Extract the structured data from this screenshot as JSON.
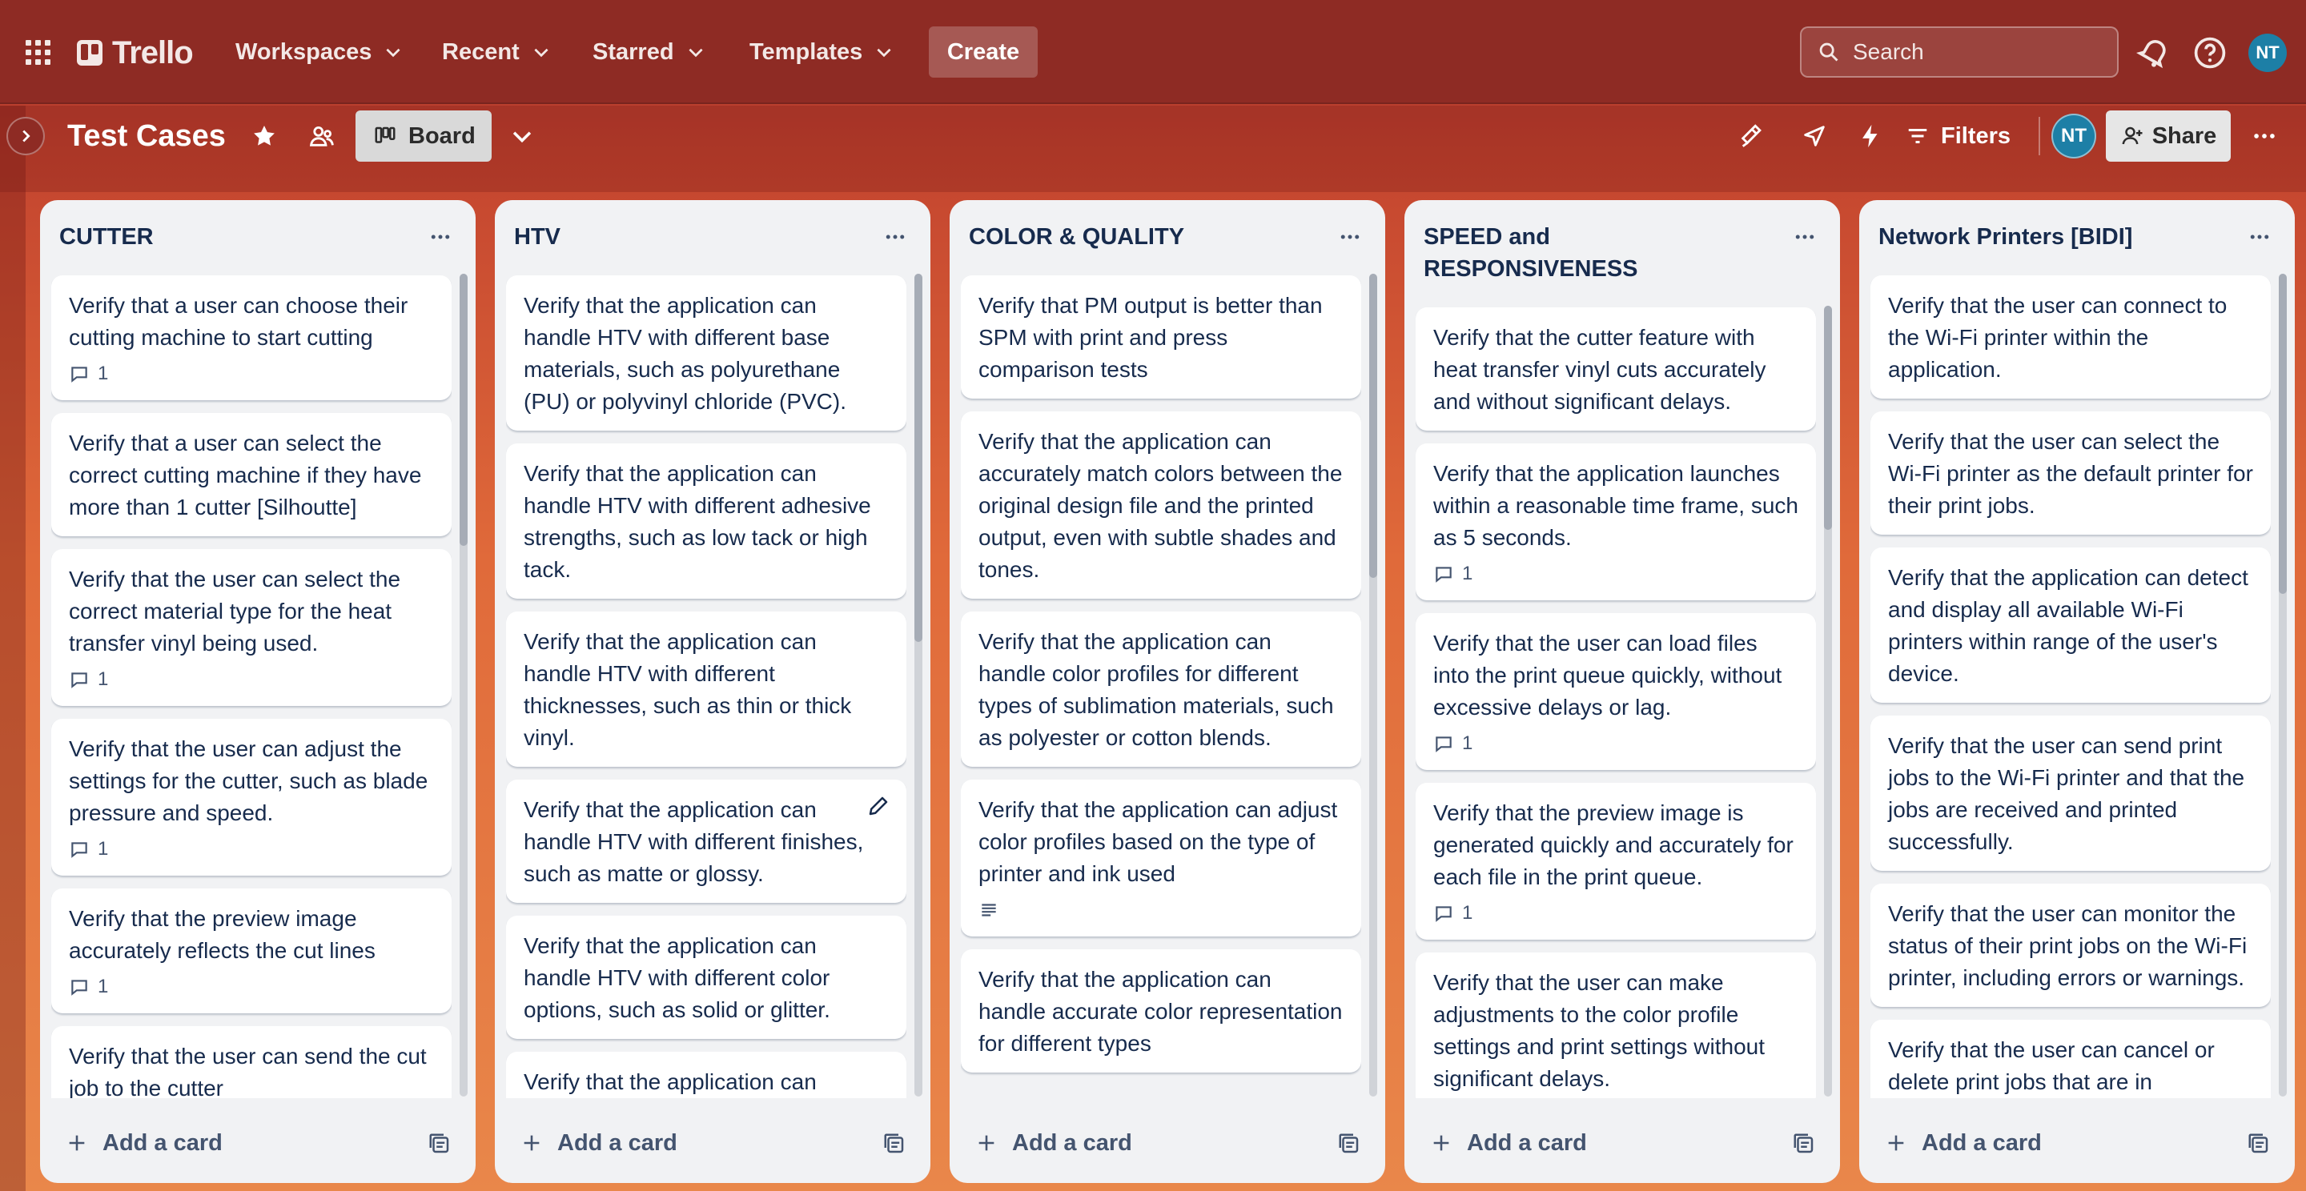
{
  "app": {
    "logo_text": "Trello"
  },
  "nav": {
    "workspaces": "Workspaces",
    "recent": "Recent",
    "starred": "Starred",
    "templates": "Templates",
    "create": "Create",
    "search_placeholder": "Search",
    "avatar_initials": "NT"
  },
  "board": {
    "title": "Test Cases",
    "view_label": "Board",
    "filters_label": "Filters",
    "share_label": "Share",
    "member_initials": "NT"
  },
  "lists": [
    {
      "title": "CUTTER",
      "cards": [
        {
          "text": "Verify that a user can choose their cutting machine to start cutting",
          "comments": "1"
        },
        {
          "text": "Verify that a user can select the correct cutting machine if they have more than 1 cutter [Silhoutte]"
        },
        {
          "text": "Verify that the user can select the correct material type for the heat transfer vinyl being used.",
          "comments": "1"
        },
        {
          "text": "Verify that the user can adjust the settings for the cutter, such as blade pressure and speed.",
          "comments": "1"
        },
        {
          "text": "Verify that the preview image accurately reflects the cut lines",
          "comments": "1"
        },
        {
          "text": "Verify that the user can send the cut job to the cutter"
        }
      ],
      "add_card": "Add a card"
    },
    {
      "title": "HTV",
      "cards": [
        {
          "text": "Verify that the application can handle HTV with different base materials, such as polyurethane (PU) or polyvinyl chloride (PVC)."
        },
        {
          "text": "Verify that the application can handle HTV with different adhesive strengths, such as low tack or high tack."
        },
        {
          "text": "Verify that the application can handle HTV with different thicknesses, such as thin or thick vinyl."
        },
        {
          "text": "Verify that the application can handle HTV with different finishes, such as matte or glossy.",
          "editing": true
        },
        {
          "text": "Verify that the application can handle HTV with different color options, such as solid or glitter."
        },
        {
          "text": "Verify that the application can handle HTV with different"
        }
      ],
      "add_card": "Add a card"
    },
    {
      "title": "COLOR & QUALITY",
      "cards": [
        {
          "text": "Verify that PM output is better than SPM with print and press comparison tests"
        },
        {
          "text": "Verify that the application can accurately match colors between the original design file and the printed output, even with subtle shades and tones."
        },
        {
          "text": "Verify that the application can handle color profiles for different types of sublimation materials, such as polyester or cotton blends."
        },
        {
          "text": "Verify that the application can adjust color profiles based on the type of printer and ink used",
          "description": true
        },
        {
          "text": "Verify that the application can handle accurate color representation for different types"
        }
      ],
      "add_card": "Add a card"
    },
    {
      "title": "SPEED and RESPONSIVENESS",
      "cards": [
        {
          "text": "Verify that the cutter feature with heat transfer vinyl cuts accurately and without significant delays."
        },
        {
          "text": "Verify that the application launches within a reasonable time frame, such as 5 seconds.",
          "comments": "1"
        },
        {
          "text": "Verify that the user can load files into the print queue quickly, without excessive delays or lag.",
          "comments": "1"
        },
        {
          "text": "Verify that the preview image is generated quickly and accurately for each file in the print queue.",
          "comments": "1"
        },
        {
          "text": "Verify that the user can make adjustments to the color profile settings and print settings without significant delays."
        }
      ],
      "add_card": "Add a card"
    },
    {
      "title": "Network Printers [BIDI]",
      "cards": [
        {
          "text": "Verify that the user can connect to the Wi-Fi printer within the application."
        },
        {
          "text": "Verify that the user can select the Wi-Fi printer as the default printer for their print jobs."
        },
        {
          "text": "Verify that the application can detect and display all available Wi-Fi printers within range of the user's device."
        },
        {
          "text": "Verify that the user can send print jobs to the Wi-Fi printer and that the jobs are received and printed successfully."
        },
        {
          "text": "Verify that the user can monitor the status of their print jobs on the Wi-Fi printer, including errors or warnings."
        },
        {
          "text": "Verify that the user can cancel or delete print jobs that are in"
        }
      ],
      "add_card": "Add a card"
    }
  ]
}
